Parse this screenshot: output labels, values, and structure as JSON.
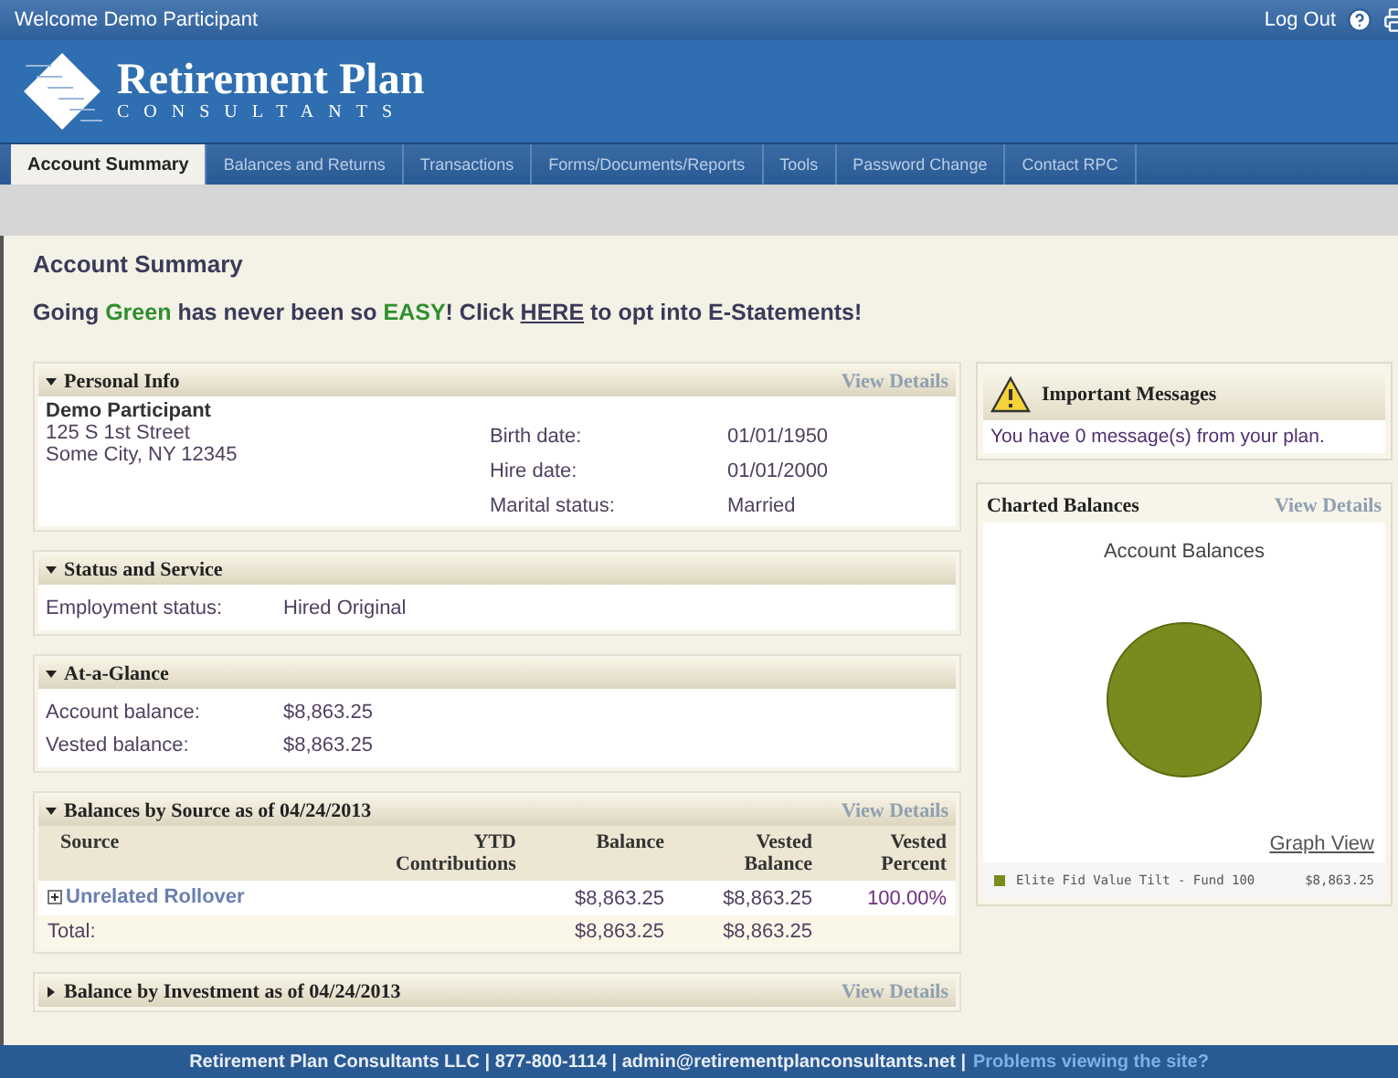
{
  "top_bar": {
    "welcome": "Welcome  Demo Participant",
    "logout": "Log Out"
  },
  "logo": {
    "name": "Retirement Plan",
    "tagline": "CONSULTANTS"
  },
  "tabs": [
    {
      "label": "Account Summary",
      "selected": true
    },
    {
      "label": "Balances and Returns",
      "selected": false
    },
    {
      "label": "Transactions",
      "selected": false
    },
    {
      "label": "Forms/Documents/Reports",
      "selected": false
    },
    {
      "label": "Tools",
      "selected": false
    },
    {
      "label": "Password Change",
      "selected": false
    },
    {
      "label": "Contact RPC",
      "selected": false
    }
  ],
  "page_title": "Account Summary",
  "promo": [
    {
      "text": "Going ",
      "kind": "plain"
    },
    {
      "text": "Green",
      "kind": "green"
    },
    {
      "text": " has never been so ",
      "kind": "plain"
    },
    {
      "text": "EASY",
      "kind": "green"
    },
    {
      "text": "! Click ",
      "kind": "plain"
    },
    {
      "text": "HERE",
      "kind": "link"
    },
    {
      "text": " to opt into E-Statements!",
      "kind": "plain"
    }
  ],
  "personal_info": {
    "title": "Personal Info",
    "expanded": true,
    "view_details": "View Details",
    "name": "Demo Participant",
    "address": [
      "125 S 1st Street",
      "Some City, NY 12345"
    ],
    "fields": [
      {
        "label": "Birth date:",
        "value": "01/01/1950"
      },
      {
        "label": "Hire date:",
        "value": "01/01/2000"
      },
      {
        "label": "Marital status:",
        "value": "Married"
      }
    ]
  },
  "status_and_service": {
    "title": "Status and Service",
    "expanded": true,
    "fields": [
      {
        "label": "Employment status:",
        "value": "Hired Original"
      }
    ]
  },
  "at_a_glance": {
    "title": "At-a-Glance",
    "expanded": true,
    "fields": [
      {
        "label": "Account balance:",
        "value": "$8,863.25"
      },
      {
        "label": "Vested balance:",
        "value": "$8,863.25"
      }
    ]
  },
  "balances_by_source": {
    "title": "Balances by Source as of 04/24/2013",
    "expanded": true,
    "view_details": "View Details",
    "columns": [
      [
        "Source"
      ],
      [
        "YTD",
        "Contributions"
      ],
      [
        "Balance"
      ],
      [
        "Vested",
        "Balance"
      ],
      [
        "Vested",
        "Percent"
      ]
    ],
    "rows": [
      {
        "source": "Unrelated Rollover",
        "ytd": "",
        "balance": "$8,863.25",
        "vested_balance": "$8,863.25",
        "vested_percent": "100.00%"
      }
    ],
    "total": {
      "label": "Total:",
      "balance": "$8,863.25",
      "vested_balance": "$8,863.25"
    }
  },
  "balance_by_investment": {
    "title": "Balance by Investment as of 04/24/2013",
    "expanded": false,
    "view_details": "View Details"
  },
  "important_messages": {
    "title": "Important Messages",
    "text": "You have 0 message(s) from your plan."
  },
  "charted_balances": {
    "title": "Charted Balances",
    "view_details": "View Details",
    "graph_view": "Graph View",
    "chart_title": "Account Balances",
    "legend": [
      {
        "label": "Elite Fid Value Tilt - Fund 100",
        "value": "$8,863.25",
        "color": "#7a8a1e"
      }
    ]
  },
  "footer": {
    "text": "Retirement Plan Consultants LLC | 877-800-1114 | admin@retirementplanconsultants.net |",
    "link": "Problems viewing the site?"
  }
}
